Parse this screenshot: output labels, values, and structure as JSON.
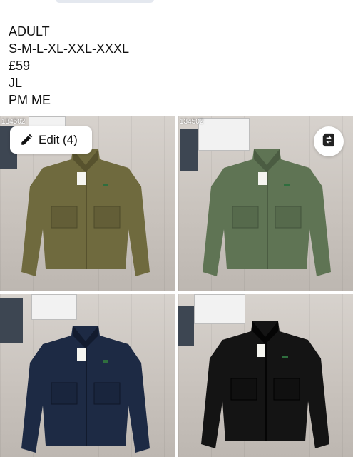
{
  "caption": {
    "lines": [
      "ADULT",
      "S-M-L-XL-XXL-XXXL",
      "£59",
      "JL",
      "PM ME"
    ]
  },
  "edit_button": {
    "label": "Edit (4)"
  },
  "photos": [
    {
      "code": "134502",
      "jacket_color": "#6f6a3e",
      "jacket_dark": "#57522e"
    },
    {
      "code": "134502",
      "jacket_color": "#5f7454",
      "jacket_dark": "#4b5c42"
    },
    {
      "code": "",
      "jacket_color": "#1d2a44",
      "jacket_dark": "#121b2e"
    },
    {
      "code": "",
      "jacket_color": "#141414",
      "jacket_dark": "#050505"
    }
  ],
  "icons": {
    "edit": "pencil-icon",
    "swap": "swap-photos-icon"
  }
}
